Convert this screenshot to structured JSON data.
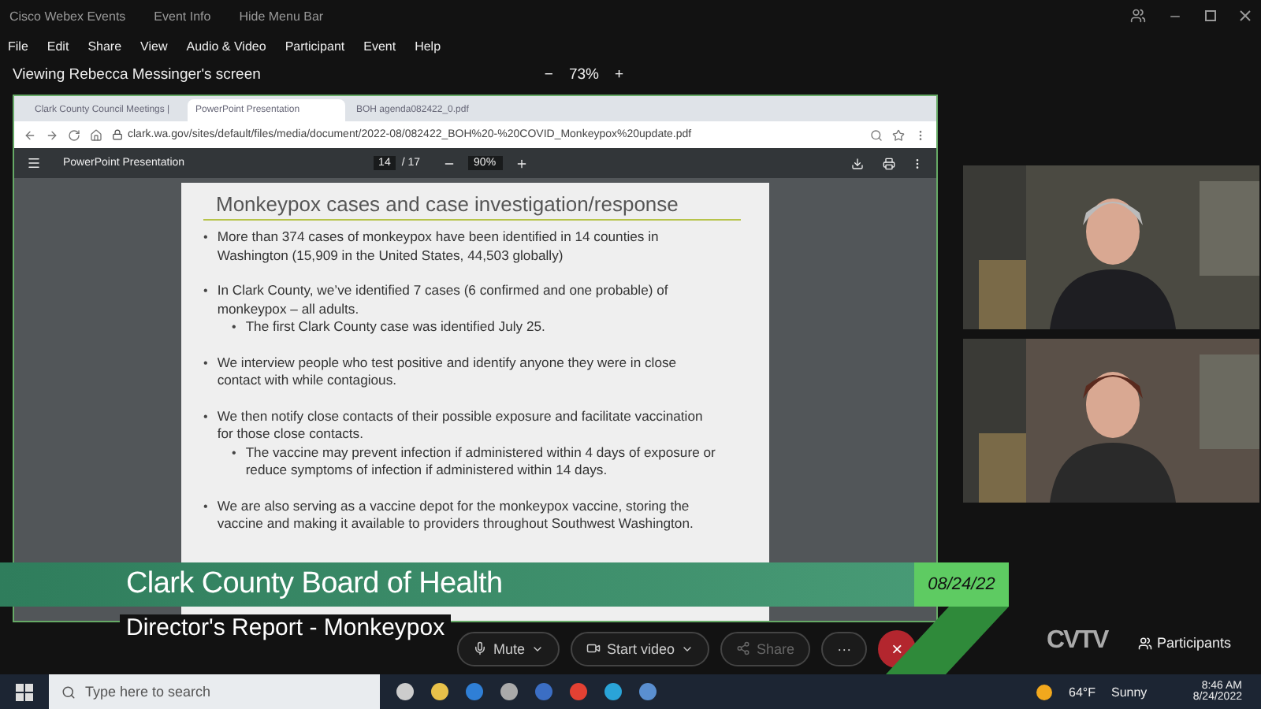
{
  "app_bar": {
    "title": "Cisco Webex Events",
    "event_info": "Event Info",
    "hide_menu": "Hide Menu Bar"
  },
  "menu": [
    "File",
    "Edit",
    "Share",
    "View",
    "Audio & Video",
    "Participant",
    "Event",
    "Help"
  ],
  "share_bar": {
    "viewing": "Viewing Rebecca Messinger's screen",
    "zoom": "73%",
    "zoom_out": "−",
    "zoom_in": "+"
  },
  "browser": {
    "tabs": [
      {
        "label": "Clark County Council Meetings |",
        "selected": false
      },
      {
        "label": "PowerPoint Presentation",
        "selected": true
      },
      {
        "label": "BOH agenda082422_0.pdf",
        "selected": false
      }
    ],
    "url": "clark.wa.gov/sites/default/files/media/document/2022-08/082422_BOH%20-%20COVID_Monkeypox%20update.pdf",
    "pdf": {
      "title": "PowerPoint Presentation",
      "page": "14",
      "pages": "/ 17",
      "zoom": "90%"
    }
  },
  "slide": {
    "title": "Monkeypox cases and case investigation/response",
    "bullets": [
      {
        "marker": "•",
        "text": "More than 374 cases of monkeypox have been identified in 14 counties in Washington (15,909 in the United States, 44,503 globally)"
      },
      {
        "marker": "•",
        "text": "In Clark County, we’ve identified 7 cases (6 confirmed and one probable)  of monkeypox – all adults.",
        "children": [
          {
            "marker": "•",
            "text": "The first Clark County case was identified July 25."
          }
        ]
      },
      {
        "marker": "•",
        "text": "We interview people who test positive and identify anyone they were in close contact with while contagious."
      },
      {
        "marker": "•",
        "text": "We then notify close contacts of their possible exposure and facilitate vaccination for those close contacts.",
        "children": [
          {
            "marker": "•",
            "text": "The vaccine may prevent infection if administered within 4 days of exposure or reduce symptoms of infection if administered within 14 days."
          }
        ]
      },
      {
        "marker": "•",
        "text": "We are also serving as a vaccine depot for the monkeypox vaccine, storing the vaccine and making it available to providers throughout Southwest Washington."
      }
    ]
  },
  "lower_third": {
    "title": "Clark County Board of Health",
    "subtitle": "Director's Report - Monkeypox",
    "date": "08/24/22",
    "logo": "CVTV"
  },
  "controls": [
    {
      "kind": "split",
      "label": "Mute"
    },
    {
      "kind": "split",
      "label": "Start video"
    },
    {
      "kind": "plain",
      "label": "Share"
    },
    {
      "kind": "more",
      "label": "···"
    },
    {
      "kind": "end",
      "label": "×"
    }
  ],
  "participants": "Participants",
  "taskbar": {
    "search": {
      "placeholder": "Type here to search"
    },
    "weather": "64°F",
    "condition": "Sunny",
    "time": "8:46 AM",
    "date": "8/24/2022"
  }
}
